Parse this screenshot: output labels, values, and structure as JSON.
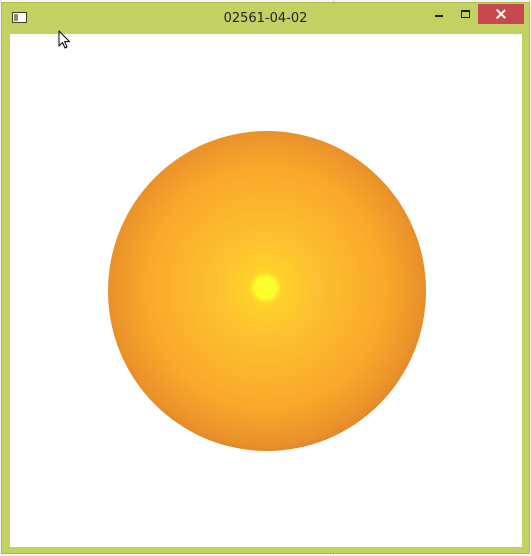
{
  "window": {
    "title": "02561-04-02",
    "controls": {
      "minimize_icon": "minimize-icon",
      "maximize_icon": "maximize-icon",
      "close_icon": "close-icon"
    }
  },
  "colors": {
    "frame": "#c3d162",
    "close_button": "#c7484e",
    "client_background": "#ffffff",
    "sphere_highlight": "#fbff2a",
    "sphere_mid": "#f9a82a",
    "sphere_edge": "#5a1a26"
  },
  "canvas": {
    "content": "shaded-sphere"
  }
}
